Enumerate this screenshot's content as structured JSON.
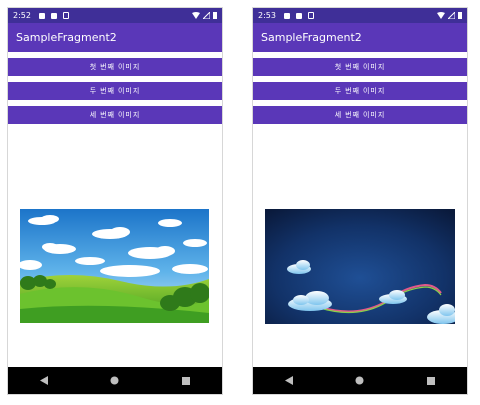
{
  "left": {
    "time": "2:52",
    "title": "SampleFragment2",
    "buttons": [
      "첫 번째 이미지",
      "두 번째 이미지",
      "세 번째 이미지"
    ]
  },
  "right": {
    "time": "2:53",
    "title": "SampleFragment2",
    "buttons": [
      "첫 번째 이미지",
      "두 번째 이미지",
      "세 번째 이미지"
    ]
  },
  "colors": {
    "statusbar": "#3f2f98",
    "appbar": "#5a37b8",
    "button": "#5a37b8",
    "navbar": "#000000"
  },
  "icons": [
    "notification-icon",
    "sd-card-icon",
    "clipboard-icon",
    "wifi-icon",
    "signal-icon",
    "battery-icon",
    "back-icon",
    "home-icon",
    "recents-icon"
  ]
}
